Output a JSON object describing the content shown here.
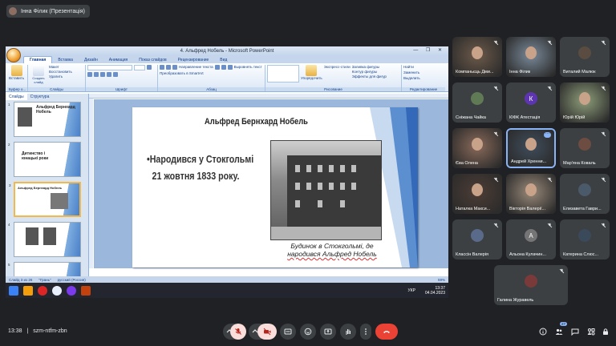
{
  "meet": {
    "presenter_label": "Інна Філик (Презентація)",
    "time": "13:38",
    "code": "szm-ntfm-zbn",
    "participants_count": "27"
  },
  "ppt": {
    "window_title": "4. Альфред Нобель - Microsoft PowerPoint",
    "window_controls": "— ❐ ✕",
    "tabs": [
      "Главная",
      "Вставка",
      "Дизайн",
      "Анимация",
      "Показ слайдов",
      "Рецензирование",
      "Вид"
    ],
    "groups": {
      "clipboard": {
        "name": "Буфер о...",
        "paste": "Вставить",
        "cut": "Вырезать",
        "copy": "Копировать"
      },
      "slides": {
        "name": "Слайды",
        "new": "Создать слайд",
        "layout": "Макет",
        "restore": "Восстановить",
        "delete": "Удалить"
      },
      "font": {
        "name": "Шрифт"
      },
      "paragraph": {
        "name": "Абзац",
        "dir": "Направление текста",
        "align": "Выровнять текст",
        "smartart": "Преобразовать в SmartArt"
      },
      "drawing": {
        "name": "Рисование",
        "arrange": "Упорядочить",
        "styles": "Экспресс-стили",
        "fill": "Заливка фигуры",
        "outline": "Контур фигуры",
        "effects": "Эффекты для фигур"
      },
      "editing": {
        "name": "Редактирование",
        "find": "Найти",
        "replace": "Заменить",
        "select": "Выделить"
      }
    },
    "pane_tabs": [
      "Слайды",
      "Структура"
    ],
    "thumbs": [
      {
        "n": "1",
        "title": "Альфред Бернхард Нобель"
      },
      {
        "n": "2",
        "title": "Дитинство і юнацькі роки"
      },
      {
        "n": "3",
        "title": "Альфред Бернхард Нобель"
      },
      {
        "n": "4",
        "title": ""
      },
      {
        "n": "5",
        "title": ""
      }
    ],
    "status": {
      "slide": "Слайд 3 из 26",
      "theme": "\"Грань\"",
      "lang": "русский (Россия)",
      "zoom": "59%"
    },
    "taskbar": {
      "lang": "УКР",
      "time": "13:37",
      "date": "04.04.2023"
    }
  },
  "slide": {
    "title": "Альфред Бернхард Нобель",
    "bullet_line1": "•Народився у Стокгольмі",
    "bullet_line2": "21 жовтня 1833 року.",
    "caption_line1": "Будинок в Стокгольмі, де",
    "caption_line2": "народився Альфред Нобель"
  },
  "participants": [
    {
      "name": "Компаньєць Дми...",
      "type": "video",
      "color": "#6d5a4a"
    },
    {
      "name": "Інна Філик",
      "type": "video",
      "color": "#7a8a9a"
    },
    {
      "name": "Виталий Малюк",
      "type": "photo",
      "color": "#5a4c40"
    },
    {
      "name": "Сніжана Чайка",
      "type": "photo",
      "color": "#5f7a55"
    },
    {
      "name": "КІФК Атестація",
      "type": "letter",
      "letter": "К",
      "color": "#5e35b1"
    },
    {
      "name": "Юрій Юрій",
      "type": "video",
      "color": "#8e9e7a"
    },
    {
      "name": "Єва Олена",
      "type": "video",
      "color": "#8a6a5a"
    },
    {
      "name": "Андрей Хренни...",
      "type": "video",
      "color": "#3f4d5c"
    },
    {
      "name": "Мар'яна Коваль",
      "type": "photo",
      "color": "#6d4c41"
    },
    {
      "name": "Наталка Макси...",
      "type": "video",
      "color": "#4d3d35"
    },
    {
      "name": "Вікторія Валерії...",
      "type": "video",
      "color": "#9a8a7a"
    },
    {
      "name": "Елизавета Гаври...",
      "type": "photo",
      "color": "#4a5a6a"
    },
    {
      "name": "Классін Валерія",
      "type": "photo",
      "color": "#5a6a8a"
    },
    {
      "name": "Альона Кулачин...",
      "type": "letter",
      "letter": "А",
      "color": "#757575"
    },
    {
      "name": "Катерина Слюс...",
      "type": "photo",
      "color": "#3a4a5a"
    },
    {
      "name": "Галина Журавель",
      "type": "photo",
      "color": "#7b3a3a"
    }
  ]
}
